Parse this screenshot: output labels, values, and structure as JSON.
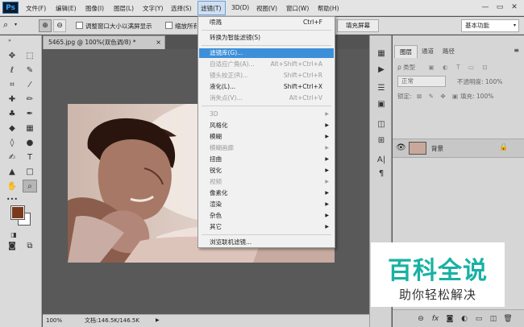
{
  "app": {
    "logo": "Ps"
  },
  "menubar": {
    "items": [
      "文件(F)",
      "编辑(E)",
      "图像(I)",
      "图层(L)",
      "文字(Y)",
      "选择(S)",
      "滤镜(T)",
      "3D(D)",
      "视图(V)",
      "窗口(W)",
      "帮助(H)"
    ]
  },
  "window_controls": {
    "minimize": "—",
    "restore": "▭",
    "close": "✕"
  },
  "options_bar": {
    "resize_label": "调整窗口大小以满屏显示",
    "zoom_all_label": "缩放所有",
    "fill_screen": "填充屏幕",
    "workspace": "基本功能"
  },
  "document": {
    "tab_title": "5465.jpg @ 100%(双色调/8) *",
    "close": "×"
  },
  "status": {
    "zoom": "100%",
    "doc_info": "文档:146.5K/146.5K"
  },
  "filter_menu": {
    "items": [
      {
        "label": "喷溅",
        "shortcut": "Ctrl+F",
        "state": "normal"
      },
      {
        "label": "转换为智能滤镜(S)",
        "shortcut": "",
        "state": "normal"
      },
      {
        "label": "滤镜库(G)...",
        "shortcut": "",
        "state": "highlight"
      },
      {
        "label": "自适应广角(A)...",
        "shortcut": "Alt+Shift+Ctrl+A",
        "state": "disabled"
      },
      {
        "label": "镜头校正(R)...",
        "shortcut": "Shift+Ctrl+R",
        "state": "disabled"
      },
      {
        "label": "液化(L)...",
        "shortcut": "Shift+Ctrl+X",
        "state": "normal"
      },
      {
        "label": "消失点(V)...",
        "shortcut": "Alt+Ctrl+V",
        "state": "disabled"
      },
      {
        "label": "3D",
        "submenu": true,
        "state": "disabled"
      },
      {
        "label": "风格化",
        "submenu": true,
        "state": "normal"
      },
      {
        "label": "模糊",
        "submenu": true,
        "state": "normal"
      },
      {
        "label": "模糊画廊",
        "submenu": true,
        "state": "disabled"
      },
      {
        "label": "扭曲",
        "submenu": true,
        "state": "normal"
      },
      {
        "label": "锐化",
        "submenu": true,
        "state": "normal"
      },
      {
        "label": "视频",
        "submenu": true,
        "state": "disabled"
      },
      {
        "label": "像素化",
        "submenu": true,
        "state": "normal"
      },
      {
        "label": "渲染",
        "submenu": true,
        "state": "normal"
      },
      {
        "label": "杂色",
        "submenu": true,
        "state": "normal"
      },
      {
        "label": "其它",
        "submenu": true,
        "state": "normal"
      },
      {
        "label": "浏览联机滤镜...",
        "shortcut": "",
        "state": "normal"
      }
    ],
    "submenu_arrow": "▶"
  },
  "layers_panel": {
    "tabs": [
      "图层",
      "通道",
      "路径"
    ],
    "kind_filter": "ρ 类型",
    "blend_mode": "正常",
    "opacity": "不透明度: 100%",
    "lock_label": "锁定:",
    "fill": "填充: 100%",
    "layer_name": "背景"
  },
  "watermark": {
    "title": "百科全说",
    "subtitle": "助你轻松解决"
  }
}
